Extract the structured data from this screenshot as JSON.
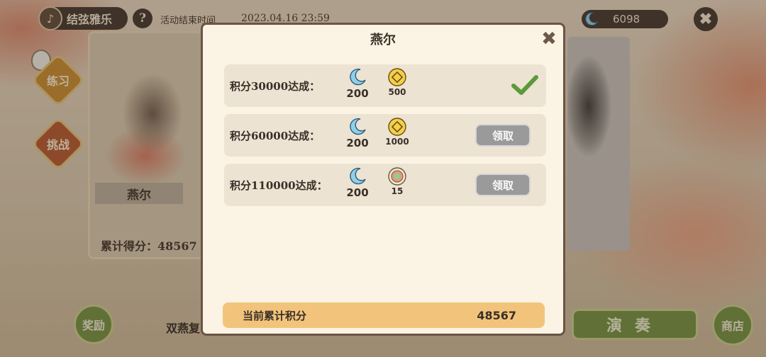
{
  "topbar": {
    "title": "结弦雅乐",
    "help_label": "?",
    "event_end_label": "活动结束时间",
    "event_end_date": "2023.04.16 23:59",
    "currency_value": "6098",
    "close_label": "✖"
  },
  "left_panel": {
    "practice_label": "练习",
    "challenge_label": "挑战",
    "character_name": "燕尔",
    "total_score_line": "累计得分：48567"
  },
  "bottom": {
    "reward_label": "奖励",
    "song_title": "双燕复",
    "play_label": "演奏",
    "shop_label": "商店"
  },
  "modal": {
    "title": "燕尔",
    "close_label": "✖",
    "rows": [
      {
        "label": "积分30000达成：",
        "reward1": "200",
        "reward1_icon": "moon-icon",
        "reward2": "500",
        "reward2_icon": "coin-icon",
        "status": "claimed"
      },
      {
        "label": "积分60000达成：",
        "reward1": "200",
        "reward1_icon": "moon-icon",
        "reward2": "1000",
        "reward2_icon": "coin-icon",
        "status": "claimable",
        "button_label": "领取"
      },
      {
        "label": "积分110000达成：",
        "reward1": "200",
        "reward1_icon": "moon-icon",
        "reward2": "15",
        "reward2_icon": "jade-disc-icon",
        "status": "claimable",
        "button_label": "领取"
      }
    ],
    "current_score_label": "当前累计积分",
    "current_score_value": "48567"
  },
  "colors": {
    "modal_bg": "#fbf3e3",
    "row_bg": "#ece3d2",
    "score_bar": "#f2c47b",
    "button_grey": "#9a9a9a",
    "check_green": "#5a9a3a",
    "play_green": "#6f8f3e"
  }
}
